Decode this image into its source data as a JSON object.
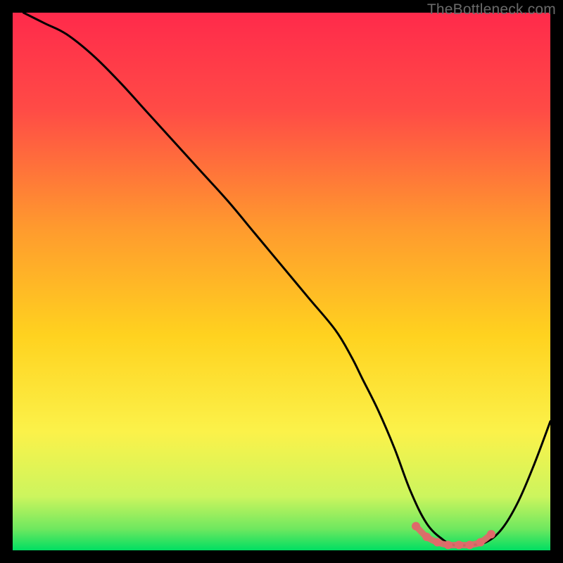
{
  "watermark": "TheBottleneck.com",
  "chart_data": {
    "type": "line",
    "title": "",
    "xlabel": "",
    "ylabel": "",
    "xlim": [
      0,
      100
    ],
    "ylim": [
      0,
      100
    ],
    "grid": false,
    "legend": false,
    "background_gradient": {
      "top": "#ff2a4b",
      "middle": "#ffd400",
      "bottom": "#00e060"
    },
    "series": [
      {
        "name": "bottleneck-curve",
        "x": [
          2,
          6,
          10,
          15,
          20,
          25,
          30,
          35,
          40,
          45,
          50,
          55,
          60,
          63,
          65,
          68,
          71,
          74,
          77,
          80,
          82,
          85,
          88,
          91,
          94,
          97,
          100
        ],
        "y": [
          100,
          98,
          96,
          92,
          87,
          81.5,
          76,
          70.5,
          65,
          59,
          53,
          47,
          41,
          36,
          32,
          26,
          19,
          11,
          5,
          2,
          1,
          1,
          1.5,
          4,
          9,
          16,
          24
        ],
        "color": "#000000"
      },
      {
        "name": "optimal-range-marker",
        "x": [
          75,
          77,
          79,
          81,
          83,
          85,
          87,
          89
        ],
        "y": [
          4.5,
          2.5,
          1.5,
          1.0,
          1.0,
          1.0,
          1.5,
          3.0
        ],
        "color": "#e06a6a",
        "style": "marker-line"
      }
    ],
    "annotations": []
  }
}
